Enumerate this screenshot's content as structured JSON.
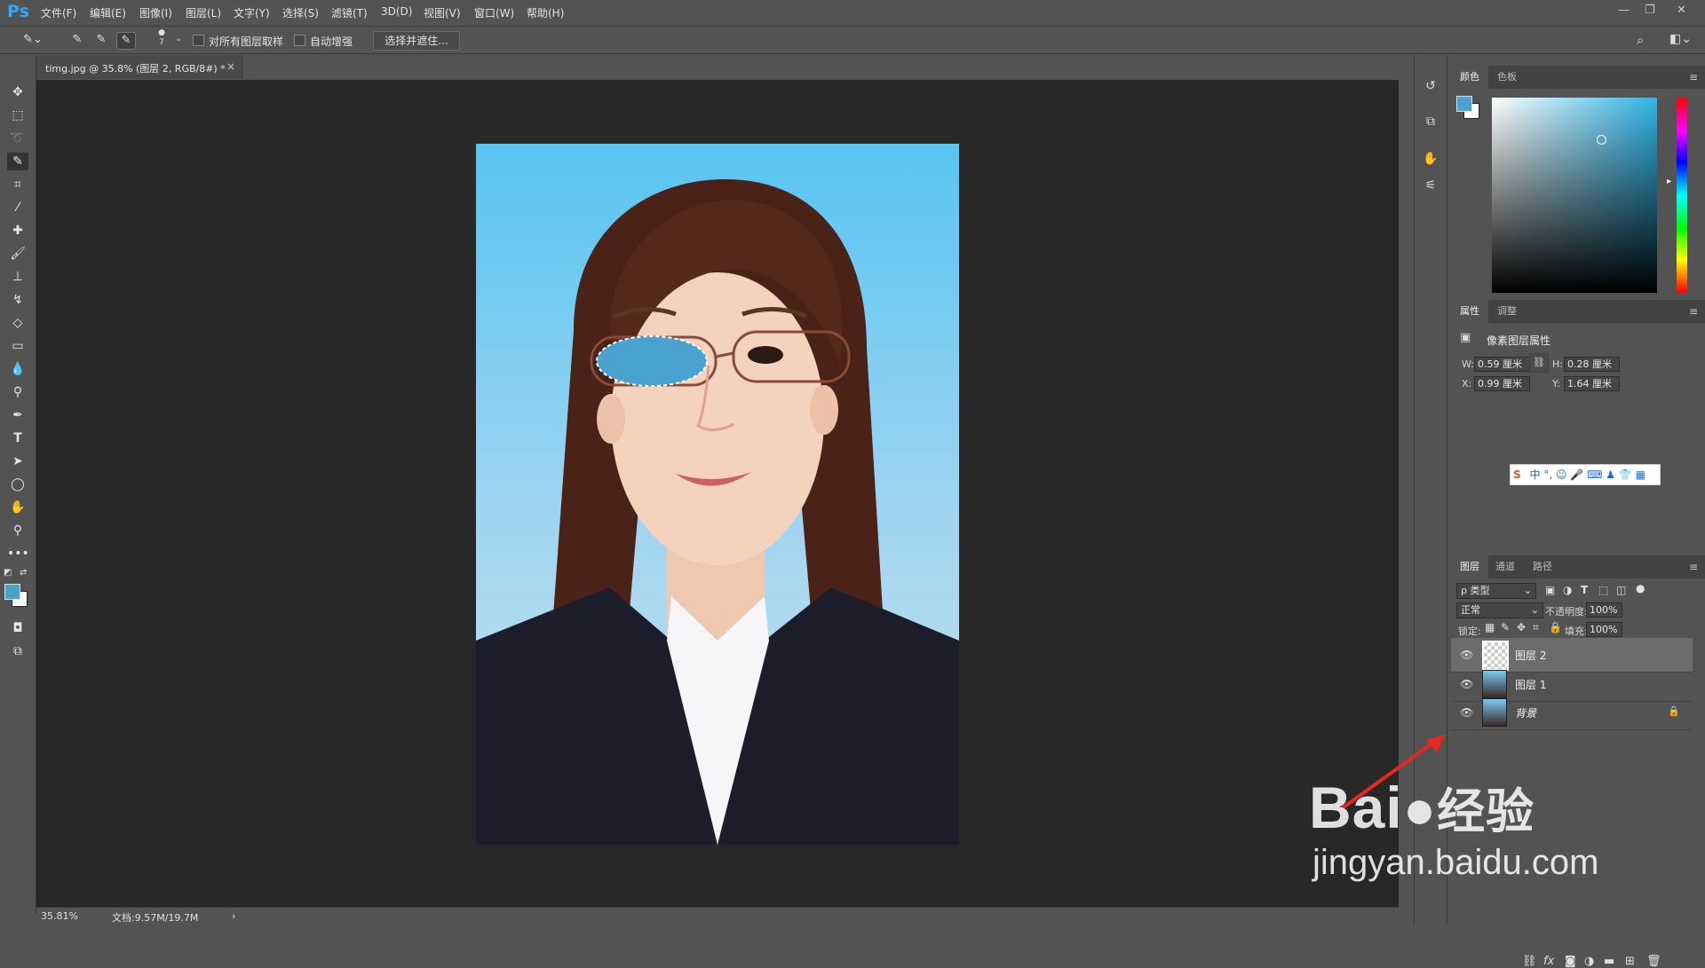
{
  "app": {
    "logo": "Ps"
  },
  "menu": {
    "items": [
      "文件(F)",
      "编辑(E)",
      "图像(I)",
      "图层(L)",
      "文字(Y)",
      "选择(S)",
      "滤镜(T)",
      "3D(D)",
      "视图(V)",
      "窗口(W)",
      "帮助(H)"
    ]
  },
  "window_controls": {
    "minimize": "—",
    "restore": "❐",
    "close": "✕"
  },
  "options": {
    "brush_size": "7",
    "sample_all_layers": "对所有图层取样",
    "auto_enhance": "自动增强",
    "refine_button": "选择并遮住..."
  },
  "document": {
    "tab_title": "timg.jpg @ 35.8% (图层 2, RGB/8#) *",
    "close": "×"
  },
  "status": {
    "zoom": "35.81%",
    "doc": "文档:9.57M/19.7M",
    "arrow": "›"
  },
  "color_panel": {
    "tabs": [
      "颜色",
      "色板"
    ],
    "foreground": "#4aa3cf",
    "background": "#ffffff",
    "hue": "#2fb3e6"
  },
  "properties_panel": {
    "tabs": [
      "属性",
      "调整"
    ],
    "title": "像素图层属性",
    "w_label": "W:",
    "w_value": "0.59 厘米",
    "h_label": "H:",
    "h_value": "0.28 厘米",
    "x_label": "X:",
    "x_value": "0.99 厘米",
    "y_label": "Y:",
    "y_value": "1.64 厘米"
  },
  "ime_toolbar": {
    "logo": "S",
    "items": [
      "中",
      "°,",
      "☺",
      "🎤",
      "⌨",
      "♟",
      "👕",
      "▦"
    ]
  },
  "layers_panel": {
    "tabs": [
      "图层",
      "通道",
      "路径"
    ],
    "filter": "ρ 类型",
    "blend_mode": "正常",
    "opacity_label": "不透明度:",
    "opacity_value": "100%",
    "lock_label": "锁定:",
    "fill_label": "填充:",
    "fill_value": "100%",
    "layers": [
      {
        "name": "图层 2",
        "selected": true
      },
      {
        "name": "图层 1",
        "selected": false
      },
      {
        "name": "背景",
        "selected": false,
        "locked": true
      }
    ]
  },
  "watermark": {
    "brand": "Bai",
    "suffix": "经验",
    "url": "jingyan.baidu.com"
  }
}
